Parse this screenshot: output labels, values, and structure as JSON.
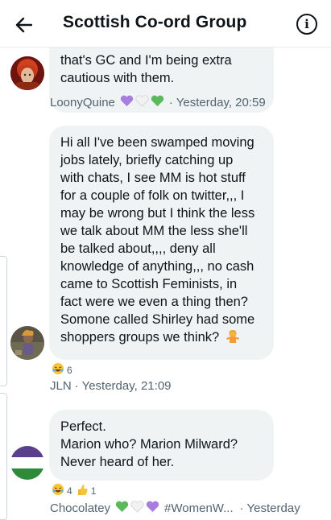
{
  "header": {
    "title": "Scottish Co-ord Group"
  },
  "messages": [
    {
      "lines": [
        "that's GC and I'm being extra",
        "cautious with them."
      ],
      "sender": "LoonyQuine",
      "time": "· Yesterday, 20:59"
    },
    {
      "lines": [
        "Hi all I've been swamped moving",
        "jobs lately, briefly catching up",
        "with chats, I see MM is hot stuff",
        "for a couple of folk on twitter,,, I",
        "may be wrong but I think the less",
        "we talk about MM the less she'll",
        "be talked about,,,, deny all",
        "knowledge of anything,,, no cash",
        "came to Scottish Feminists, in",
        "fact were we even a thing then?",
        "Somone called Shirley had some",
        "shoppers groups we think?"
      ],
      "reaction_count": "6",
      "sender": "JLN",
      "time": "· Yesterday, 21:09"
    },
    {
      "lines": [
        "Perfect.",
        "Marion who? Marion Milward?",
        "Never heard of her."
      ],
      "reaction_count_1": "4",
      "reaction_count_2": "1",
      "sender": "Chocolatey",
      "hashtag": "#WomenW...",
      "time": "· Yesterday"
    }
  ],
  "colors": {
    "bubble": "#eff3f4",
    "meta_text": "#536471",
    "purple_heart": "#9b6fd6",
    "green_heart": "#4caf50",
    "flag_purple": "#5b3f8c",
    "flag_green": "#2e8b3a"
  },
  "icons": {
    "back": "arrow-left-icon",
    "info": "info-icon"
  }
}
